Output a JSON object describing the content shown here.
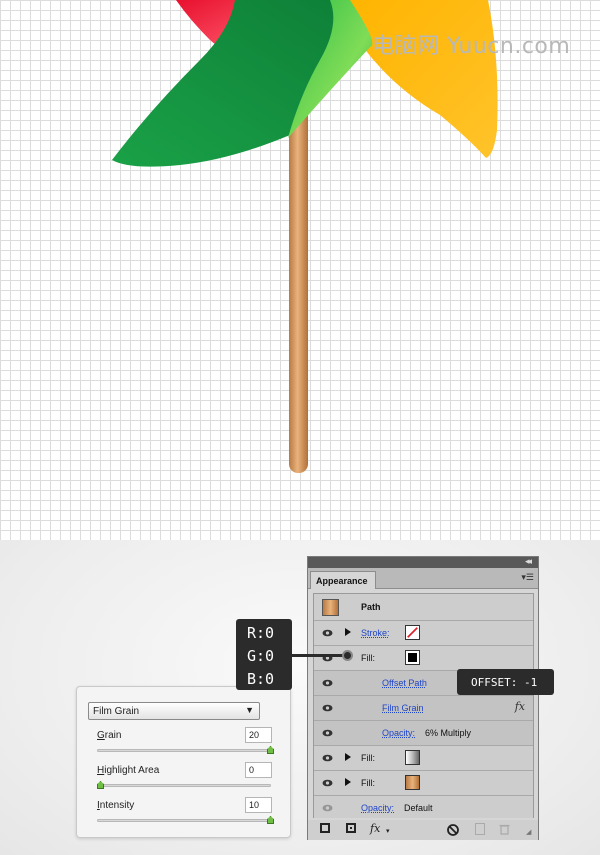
{
  "watermark": "电脑网 Yuucn.com",
  "film_grain": {
    "effect": "Film Grain",
    "sliders": [
      {
        "label_first": "G",
        "label_rest": "rain",
        "value": "20",
        "fraction": 1.0
      },
      {
        "label_first": "H",
        "label_rest": "ighlight Area",
        "value": "0",
        "fraction": 0.0
      },
      {
        "label_first": "I",
        "label_rest": "ntensity",
        "value": "10",
        "fraction": 1.0
      }
    ]
  },
  "appearance": {
    "tab": "Appearance",
    "collapse_glyph": "◂◂",
    "menu_glyph": "▾☰",
    "object": "Path",
    "rows": {
      "stroke_label": "Stroke:",
      "fill_label": "Fill:",
      "offset_path": "Offset Path",
      "film_grain": "Film Grain",
      "fx": "fx",
      "opacity_label": "Opacity:",
      "opacity_inner_value": "6% Multiply",
      "fill2_label": "Fill:",
      "fill3_label": "Fill:",
      "opacity_bottom_label": "Opacity:",
      "opacity_bottom_value": "Default"
    },
    "bottom_icons": [
      "new-art-icon",
      "duplicate-icon",
      "fx-menu-icon",
      "clear-icon",
      "new-item-icon",
      "trash-icon"
    ],
    "fx_label": "fx",
    "colors": {
      "fill": "#000000",
      "stroke_none": "#e0202a",
      "link": "#1f45c8"
    }
  },
  "callouts": {
    "rgb": [
      "R:0",
      "G:0",
      "B:0"
    ],
    "offset": "OFFSET: -1"
  }
}
